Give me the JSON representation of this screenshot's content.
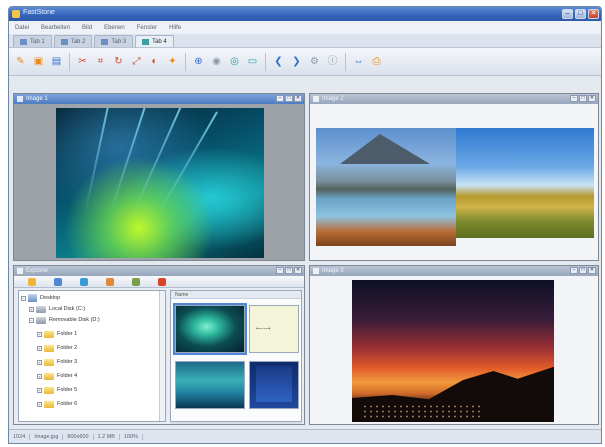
{
  "window": {
    "title": "FastStone"
  },
  "menu": [
    "Datei",
    "Bearbeiten",
    "Bild",
    "Ebenen",
    "Fenster",
    "Hilfe"
  ],
  "doc_tabs": [
    {
      "label": "Tab 1",
      "active": false
    },
    {
      "label": "Tab 2",
      "active": false
    },
    {
      "label": "Tab 3",
      "active": false
    },
    {
      "label": "Tab 4",
      "active": true
    }
  ],
  "toolbar": {
    "icons": [
      "open-icon",
      "browse-icon",
      "save-icon",
      "cut-icon",
      "crop-icon",
      "rotate-icon",
      "resize-icon",
      "color-icon",
      "effects-icon",
      "zoom-icon",
      "fit-icon",
      "actual-size-icon",
      "prev-icon",
      "next-icon",
      "settings-icon",
      "compare-icon"
    ]
  },
  "panes": {
    "pane1": {
      "title": "Image 1",
      "image": "aurora-abstract"
    },
    "pane2": {
      "title": "Image 2",
      "image": "lake-panorama"
    },
    "pane3": {
      "title": "Explorer",
      "tree": [
        "Desktop",
        "Local Disk (C:)",
        "Removable Disk (D:)",
        "Folder 1",
        "Folder 2",
        "Folder 3",
        "Folder 4",
        "Folder 5",
        "Folder 6"
      ]
    },
    "pane4": {
      "title": "Image 3",
      "image": "sunset-hills"
    }
  },
  "thumbnails": {
    "header": "Name",
    "items": [
      "thumb-aurora",
      "thumb-note",
      "thumb-water",
      "thumb-blue"
    ]
  },
  "status": [
    "1024",
    "Image.jpg",
    "800x600",
    "1.2 MB",
    "100%"
  ],
  "colors": {
    "titlebar": "#3464b8",
    "pane_active": "#4e7cc2",
    "pane_bg": "#9ea3a9"
  }
}
